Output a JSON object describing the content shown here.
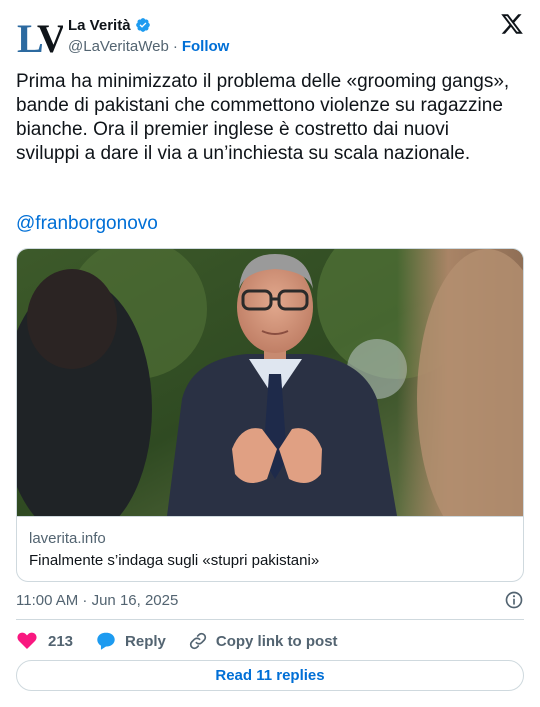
{
  "author": {
    "display_name": "La Verità",
    "handle": "@LaVeritaWeb",
    "separator": "·",
    "follow_label": "Follow",
    "avatar_text": "LV",
    "verified_color": "#1d9bf0"
  },
  "tweet": {
    "text": "Prima ha minimizzato il problema delle «grooming gangs», bande di pakistani che commettono violenze su ragazzine bianche. Ora il premier inglese è costretto dai nuovi sviluppi a dare il via a un’inchiesta su scala nazionale.",
    "mention": "@franborgonovo"
  },
  "link_card": {
    "domain": "laverita.info",
    "title": "Finalmente s’indaga sugli «stupri pakistani»"
  },
  "meta": {
    "timestamp": "11:00 AM · Jun 16, 2025"
  },
  "actions": {
    "like_count": "213",
    "reply_label": "Reply",
    "copy_label": "Copy link to post"
  },
  "read_replies_label": "Read 11 replies",
  "colors": {
    "accent": "#006fd6",
    "like": "#f91880",
    "reply": "#1d9bf0",
    "muted": "#536471",
    "border": "#cfd9de"
  },
  "icons": [
    "verified-badge-icon",
    "x-logo-icon",
    "info-icon",
    "heart-icon",
    "reply-bubble-icon",
    "link-icon"
  ]
}
